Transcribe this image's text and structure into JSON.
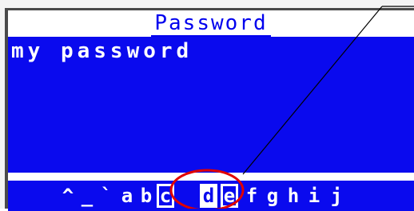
{
  "screen": {
    "title": "Password",
    "entry_value": "my password"
  },
  "char_selector": {
    "chars": [
      "^",
      "_",
      "`",
      "a",
      "b",
      "c",
      "d",
      "e",
      "f",
      "g",
      "h",
      "i",
      "j"
    ],
    "selected_char": "d"
  },
  "annotation": {
    "highlight_color": "#e00000",
    "line_color": "#000000"
  }
}
